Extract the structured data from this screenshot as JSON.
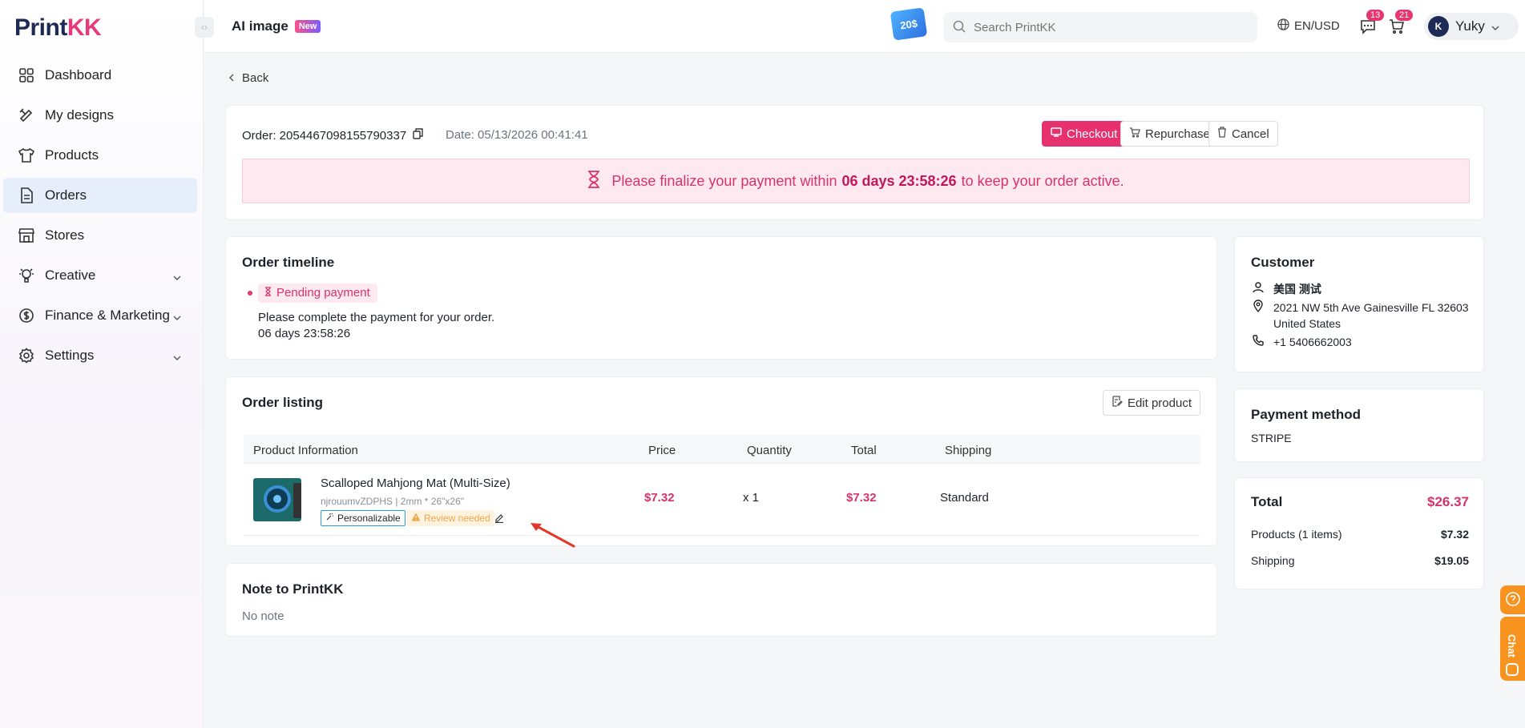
{
  "brand": {
    "logo_left": "Print",
    "logo_right": "KK"
  },
  "sidebar": {
    "collapse_label": "‹›",
    "items": [
      {
        "label": "Dashboard"
      },
      {
        "label": "My designs"
      },
      {
        "label": "Products"
      },
      {
        "label": "Orders"
      },
      {
        "label": "Stores"
      },
      {
        "label": "Creative"
      },
      {
        "label": "Finance & Marketing"
      },
      {
        "label": "Settings"
      }
    ]
  },
  "header": {
    "ai_image": "AI image",
    "new_badge": "New",
    "promo": "20$",
    "search_placeholder": "Search PrintKK",
    "lang": "EN/USD",
    "messages_count": "13",
    "cart_count": "21",
    "user_initials": "K",
    "user_name": "Yuky"
  },
  "back": "Back",
  "order": {
    "number_label": "Order: 2054467098155790337",
    "date_label": "Date: 05/13/2026 00:41:41",
    "checkout": "Checkout",
    "repurchase": "Repurchase",
    "cancel": "Cancel",
    "alert_prefix": "Please finalize your payment within",
    "alert_time": "06 days 23:58:26",
    "alert_suffix": "to keep your order active."
  },
  "timeline": {
    "title": "Order timeline",
    "status": "Pending payment",
    "message": "Please complete the payment for your order.",
    "time": "06 days 23:58:26"
  },
  "listing": {
    "title": "Order listing",
    "edit_button": "Edit product",
    "columns": [
      "Product Information",
      "Price",
      "Quantity",
      "Total",
      "Shipping"
    ],
    "rows": [
      {
        "name": "Scalloped Mahjong Mat (Multi-Size)",
        "sub": "njrouumvZDPHS | 2mm * 26\"x26\"",
        "tag_personalizable": "Personalizable",
        "tag_review": "Review needed",
        "price": "$7.32",
        "quantity": "x 1",
        "total": "$7.32",
        "shipping": "Standard"
      }
    ]
  },
  "note": {
    "title": "Note to PrintKK",
    "text": "No note"
  },
  "customer": {
    "title": "Customer",
    "name": "美国 测试",
    "address_line1": "2021 NW 5th Ave Gainesville FL 32603",
    "address_line2": "United States",
    "phone": "+1 5406662003"
  },
  "payment": {
    "title": "Payment method",
    "method": "STRIPE"
  },
  "totals": {
    "total_label": "Total",
    "total_value": "$26.37",
    "products_label": "Products (1 items)",
    "products_value": "$7.32",
    "shipping_label": "Shipping",
    "shipping_value": "$19.05"
  },
  "floating": {
    "chat": "Chat"
  },
  "colors": {
    "accent": "#e7306e",
    "sidebar_active": "#e6eefb",
    "float": "#f7931e"
  }
}
